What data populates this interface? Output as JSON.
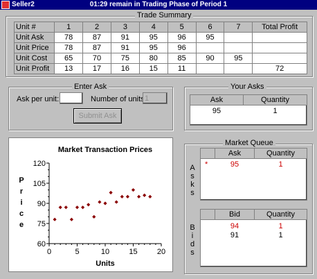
{
  "window": {
    "app_name": "Seller2",
    "status": "01:29 remain in Trading Phase of Period 1"
  },
  "trade_summary": {
    "legend": "Trade Summary",
    "columns": [
      "Unit #",
      "1",
      "2",
      "3",
      "4",
      "5",
      "6",
      "7",
      "Total Profit"
    ],
    "rows": [
      [
        "Unit Ask",
        "78",
        "87",
        "91",
        "95",
        "96",
        "95",
        "",
        ""
      ],
      [
        "Unit Price",
        "78",
        "87",
        "91",
        "95",
        "96",
        "",
        "",
        ""
      ],
      [
        "Unit Cost",
        "65",
        "70",
        "75",
        "80",
        "85",
        "90",
        "95",
        ""
      ],
      [
        "Unit Profit",
        "13",
        "17",
        "16",
        "15",
        "11",
        "",
        "",
        "72"
      ]
    ]
  },
  "enter_ask": {
    "legend": "Enter Ask",
    "ask_label": "Ask per unit:",
    "ask_value": "",
    "units_label": "Number of units:",
    "units_value": "1",
    "submit_label": "Submit Ask"
  },
  "your_asks": {
    "legend": "Your Asks",
    "columns": [
      "Ask",
      "Quantity"
    ],
    "rows": [
      [
        "95",
        "1"
      ]
    ]
  },
  "market_queue": {
    "legend": "Market Queue",
    "asks_label": [
      "A",
      "s",
      "k",
      "s"
    ],
    "bids_label": [
      "B",
      "i",
      "d",
      "s"
    ],
    "asks_columns": [
      "Ask",
      "Quantity"
    ],
    "asks_rows": [
      {
        "marker": "*",
        "ask": "95",
        "qty": "1",
        "highlight": true
      }
    ],
    "bids_columns": [
      "Bid",
      "Quantity"
    ],
    "bids_rows": [
      {
        "bid": "94",
        "qty": "1",
        "highlight": true
      },
      {
        "bid": "91",
        "qty": "1",
        "highlight": false
      }
    ]
  },
  "chart_data": {
    "type": "scatter",
    "title": "Market Transaction Prices",
    "xlabel": "Units",
    "ylabel": "Price",
    "xlim": [
      0,
      20
    ],
    "ylim": [
      60,
      120
    ],
    "x_ticks": [
      0,
      5,
      10,
      15,
      20
    ],
    "y_ticks": [
      60,
      75,
      90,
      105,
      120
    ],
    "point_color": "#8b0000",
    "points": [
      [
        1,
        78
      ],
      [
        2,
        87
      ],
      [
        3,
        87
      ],
      [
        4,
        78
      ],
      [
        5,
        87
      ],
      [
        6,
        87
      ],
      [
        7,
        89
      ],
      [
        8,
        80
      ],
      [
        9,
        91
      ],
      [
        10,
        90
      ],
      [
        11,
        98
      ],
      [
        12,
        91
      ],
      [
        13,
        95
      ],
      [
        14,
        95
      ],
      [
        15,
        100
      ],
      [
        16,
        95
      ],
      [
        17,
        96
      ],
      [
        18,
        95
      ]
    ]
  },
  "colors": {
    "titlebar": "#000080",
    "highlight": "#cc0000"
  }
}
